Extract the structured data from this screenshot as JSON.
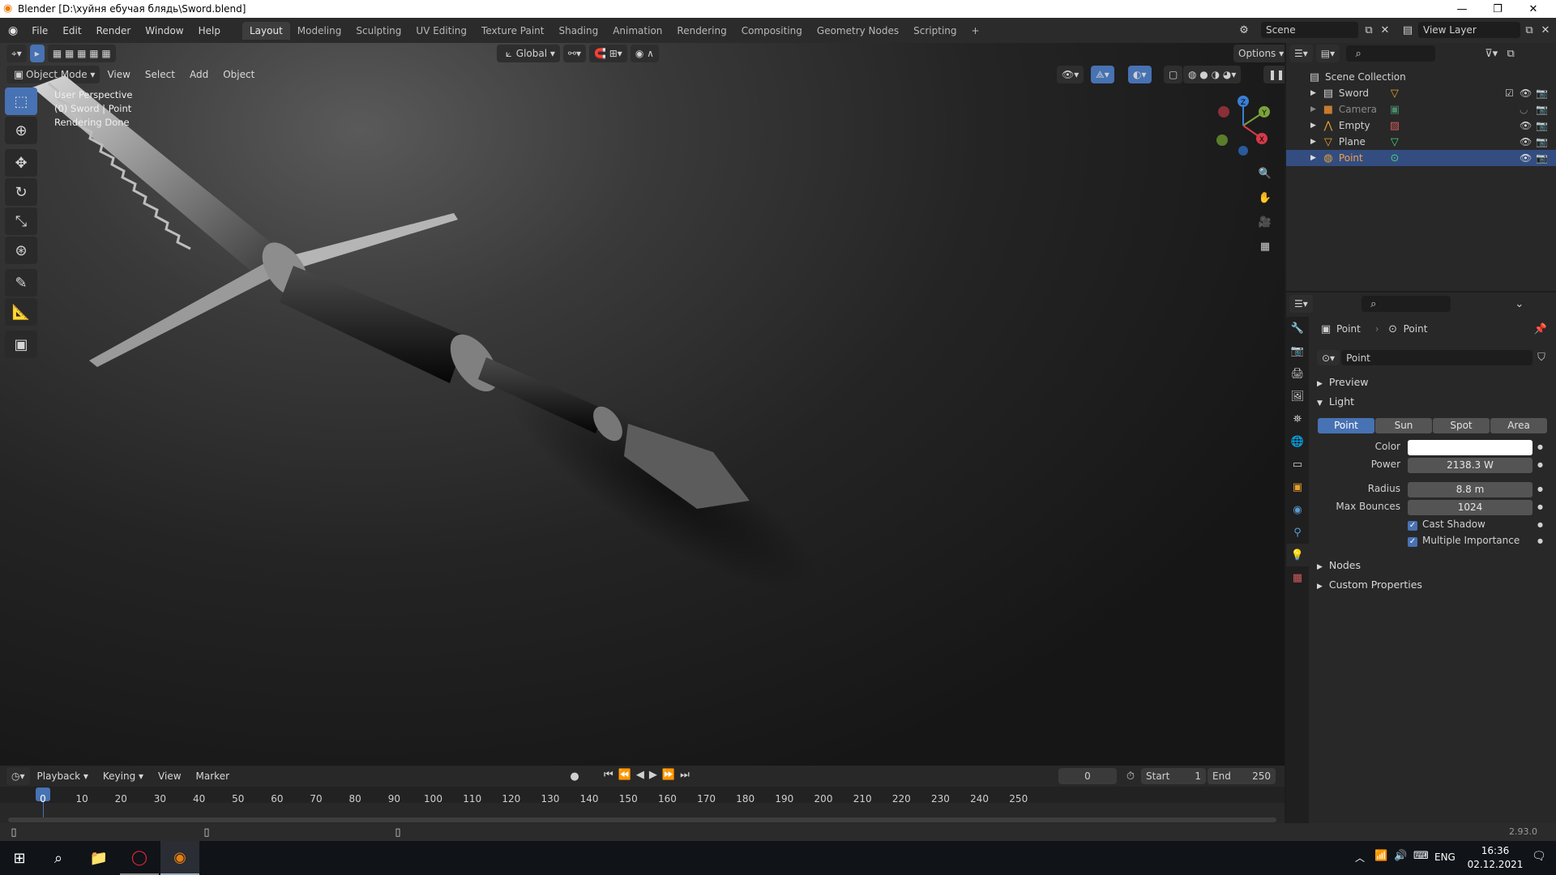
{
  "window": {
    "title": "Blender [D:\\хуйня ебучая блядь\\Sword.blend]"
  },
  "menu": [
    "File",
    "Edit",
    "Render",
    "Window",
    "Help"
  ],
  "workspaces": [
    "Layout",
    "Modeling",
    "Sculpting",
    "UV Editing",
    "Texture Paint",
    "Shading",
    "Animation",
    "Rendering",
    "Compositing",
    "Geometry Nodes",
    "Scripting"
  ],
  "scene": {
    "name": "Scene",
    "view_layer": "View Layer"
  },
  "viewport": {
    "mode": "Object Mode",
    "menus": [
      "View",
      "Select",
      "Add",
      "Object"
    ],
    "orientation": "Global",
    "options": "Options",
    "overlay": [
      "User Perspective",
      "(0) Sword | Point",
      "Rendering Done"
    ],
    "gizmo_axes": {
      "x": "X",
      "y": "Y",
      "z": "Z"
    }
  },
  "outliner": {
    "root": "Scene Collection",
    "items": [
      {
        "name": "Sword"
      },
      {
        "name": "Camera"
      },
      {
        "name": "Empty"
      },
      {
        "name": "Plane"
      },
      {
        "name": "Point"
      }
    ]
  },
  "properties": {
    "breadcrumb_object": "Point",
    "breadcrumb_data": "Point",
    "datablock": "Point",
    "panels": {
      "preview": "Preview",
      "light": "Light",
      "nodes": "Nodes",
      "custom": "Custom Properties"
    },
    "light_types": [
      "Point",
      "Sun",
      "Spot",
      "Area"
    ],
    "labels": {
      "color": "Color",
      "power": "Power",
      "radius": "Radius",
      "max_bounces": "Max Bounces"
    },
    "values": {
      "power": "2138.3 W",
      "radius": "8.8 m",
      "max_bounces": "1024"
    },
    "checks": {
      "cast_shadow": "Cast Shadow",
      "multiple_importance": "Multiple Importance"
    },
    "color_value": "#ffffff"
  },
  "timeline": {
    "menus": [
      "Playback",
      "Keying",
      "View",
      "Marker"
    ],
    "current_frame": "0",
    "start_label": "Start",
    "start": "1",
    "end_label": "End",
    "end": "250",
    "ticks": [
      "0",
      "10",
      "20",
      "30",
      "40",
      "50",
      "60",
      "70",
      "80",
      "90",
      "100",
      "110",
      "120",
      "130",
      "140",
      "150",
      "160",
      "170",
      "180",
      "190",
      "200",
      "210",
      "220",
      "230",
      "240",
      "250"
    ]
  },
  "status": {
    "version": "2.93.0"
  },
  "taskbar": {
    "lang": "ENG",
    "time": "16:36",
    "date": "02.12.2021"
  }
}
